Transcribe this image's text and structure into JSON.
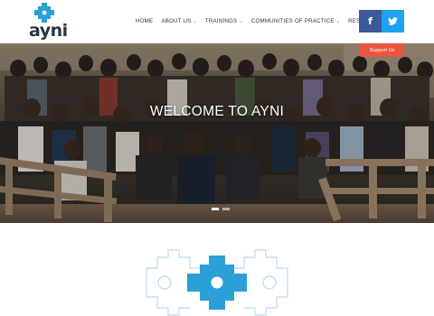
{
  "brand": {
    "name": "ayni",
    "accent": "#2a9fd8",
    "text_color": "#2a3542"
  },
  "nav": {
    "items": [
      {
        "label": "HOME",
        "has_dropdown": false
      },
      {
        "label": "ABOUT US",
        "has_dropdown": true
      },
      {
        "label": "TRAININGS",
        "has_dropdown": true
      },
      {
        "label": "COMMUNITIES OF PRACTICE",
        "has_dropdown": true
      },
      {
        "label": "RESOURCES",
        "has_dropdown": false
      }
    ]
  },
  "social": {
    "facebook_glyph": "f",
    "twitter_glyph": "t",
    "facebook_color": "#3b5998",
    "twitter_color": "#1da1f2",
    "facebook_icon": "facebook-icon",
    "twitter_icon": "twitter-icon"
  },
  "support": {
    "label": "Support Us",
    "color": "#e8563f"
  },
  "hero": {
    "title": "WELCOME TO AYNI",
    "image": "group-photo",
    "slides_total": 2,
    "active_slide": 1
  }
}
